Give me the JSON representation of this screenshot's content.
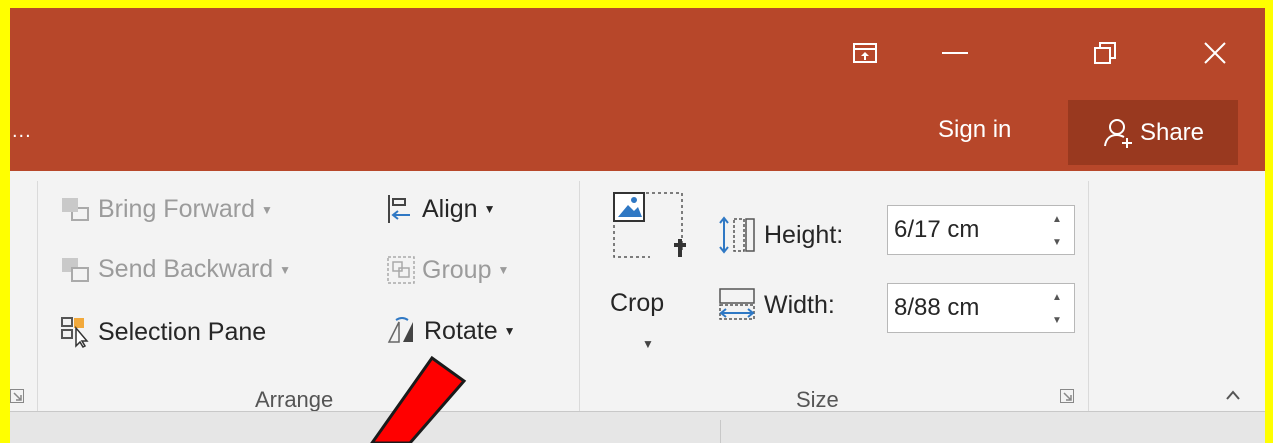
{
  "window": {
    "controls": [
      "ribbon-display-options",
      "minimize",
      "restore",
      "close"
    ]
  },
  "header": {
    "ellipsis": "...",
    "sign_in": "Sign in",
    "share": "Share"
  },
  "arrange": {
    "bring_forward": "Bring Forward",
    "send_backward": "Send Backward",
    "selection_pane": "Selection Pane",
    "align": "Align",
    "group": "Group",
    "rotate": "Rotate",
    "label": "Arrange"
  },
  "size": {
    "crop": "Crop",
    "height_label": "Height:",
    "height_value": "6/17 cm",
    "width_label": "Width:",
    "width_value": "8/88 cm",
    "label": "Size"
  },
  "colors": {
    "titlebar": "#b7472a",
    "share_bg": "#99391f",
    "ribbon": "#f3f3f3",
    "outer_border": "#ffff00",
    "annotation_arrow": "#ff0000"
  }
}
